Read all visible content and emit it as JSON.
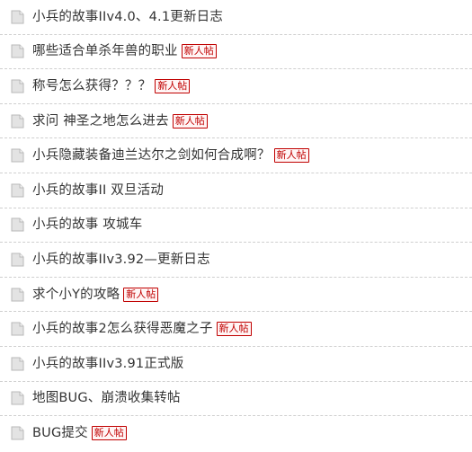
{
  "threads": [
    {
      "title": "小兵的故事IIv4.0、4.1更新日志",
      "badge": "",
      "icon": "document-icon"
    },
    {
      "title": "哪些适合单杀年兽的职业",
      "badge": "新人帖",
      "icon": "document-icon"
    },
    {
      "title": "称号怎么获得？？？",
      "badge": "新人帖",
      "icon": "document-icon"
    },
    {
      "title": "求问 神圣之地怎么进去",
      "badge": "新人帖",
      "icon": "document-icon"
    },
    {
      "title": "小兵隐藏装备迪兰达尔之剑如何合成啊？",
      "badge": "新人帖",
      "icon": "document-icon"
    },
    {
      "title": "小兵的故事II 双旦活动",
      "badge": "",
      "icon": "document-icon"
    },
    {
      "title": "小兵的故事 攻城车",
      "badge": "",
      "icon": "document-icon"
    },
    {
      "title": "小兵的故事IIv3.92—更新日志",
      "badge": "",
      "icon": "document-icon"
    },
    {
      "title": "求个小Y的攻略",
      "badge": "新人帖",
      "icon": "document-icon"
    },
    {
      "title": "小兵的故事2怎么获得恶魔之子",
      "badge": "新人帖",
      "icon": "document-icon"
    },
    {
      "title": "小兵的故事IIv3.91正式版",
      "badge": "",
      "icon": "document-icon"
    },
    {
      "title": "地图BUG、崩溃收集转帖",
      "badge": "",
      "icon": "document-icon"
    },
    {
      "title": "BUG提交",
      "badge": "新人帖",
      "icon": "document-icon"
    }
  ],
  "colors": {
    "badge_text": "#c00000",
    "badge_border": "#c00000",
    "title_text": "#333333",
    "divider": "#cfcfcf",
    "icon_fill": "#d9d9d9"
  }
}
